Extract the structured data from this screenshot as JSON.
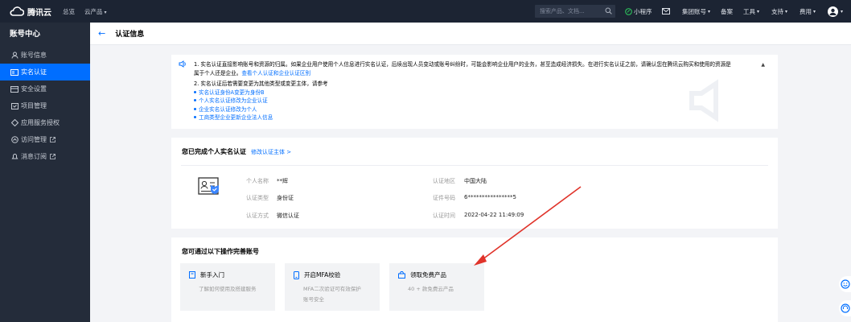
{
  "topbar": {
    "brand": "腾讯云",
    "nav_overview": "总览",
    "nav_products": "云产品",
    "search_placeholder": "搜索产品、文档...",
    "miniprogram": "小程序",
    "group_account": "集团账号",
    "record": "备案",
    "tools": "工具",
    "support": "支持",
    "fees": "费用"
  },
  "sidebar": {
    "title": "账号中心",
    "items": [
      {
        "label": "账号信息",
        "icon": "user-icon"
      },
      {
        "label": "实名认证",
        "icon": "id-card-icon"
      },
      {
        "label": "安全设置",
        "icon": "shield-icon"
      },
      {
        "label": "项目管理",
        "icon": "folder-icon"
      },
      {
        "label": "应用服务授权",
        "icon": "auth-icon"
      },
      {
        "label": "访问管理",
        "icon": "access-icon"
      },
      {
        "label": "消息订阅",
        "icon": "bell-icon"
      }
    ]
  },
  "page": {
    "title": "认证信息"
  },
  "notice": {
    "line1_a": "1. 实名认证直接影响账号和资源的归属。如果企业用户使用个人信息进行实名认证，后续出现人员变动或账号纠纷时，可能会影响企业用户的业务，甚至造成经济损失。在进行实名认证之前，请确认您在腾讯云购买和使用的资源是",
    "line1_b": "属于个人还是企业。",
    "line1_link": "查看个人认证和企业认证区别",
    "line2": "2. 实名认证后若需要变更为其他类型或变更主体，请参考",
    "links": [
      "实名认证身份A变更为身份B",
      "个人实名认证修改为企业认证",
      "企业实名认证修改为个人",
      "工商类型企业更新企业法人信息"
    ]
  },
  "auth": {
    "heading": "您已完成个人实名认证",
    "modify_link": "修改认证主体 >",
    "name_label": "个人名称",
    "name_value": "**辉",
    "type_label": "认证类型",
    "type_value": "身份证",
    "method_label": "认证方式",
    "method_value": "微信认证",
    "region_label": "认证地区",
    "region_value": "中国大陆",
    "doc_label": "证件号码",
    "doc_value": "6****************5",
    "time_label": "认证时间",
    "time_value": "2022-04-22 11:49:09"
  },
  "more": {
    "heading": "您可通过以下操作完善账号",
    "tiles": [
      {
        "title": "新手入门",
        "desc1": "了解如何使用及搭建服务",
        "desc2": ""
      },
      {
        "title": "开启MFA校验",
        "desc1": "MFA二次验证可有效保护",
        "desc2": "账号安全"
      },
      {
        "title": "领取免费产品",
        "desc1": "40 + 款免费云产品",
        "desc2": ""
      }
    ]
  },
  "colors": {
    "accent": "#006eff",
    "topbar": "#1c2433",
    "sidebar": "#242c3a",
    "arrow": "#e0332a"
  }
}
